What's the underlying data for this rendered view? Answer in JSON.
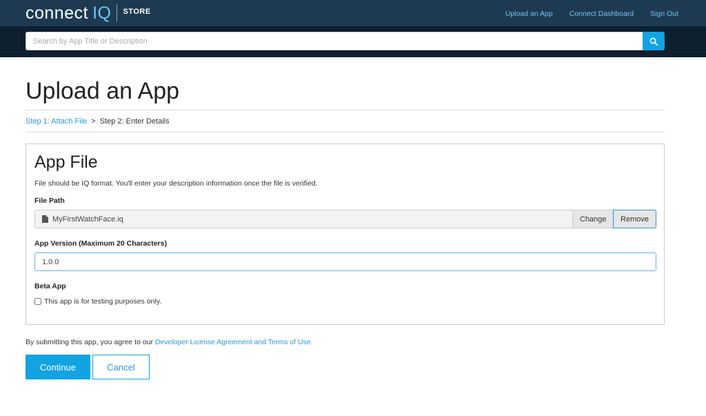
{
  "header": {
    "logo_connect": "connect",
    "logo_iq": "IQ",
    "logo_store": "STORE",
    "nav": [
      "Upload an App",
      "Connect Dashboard",
      "Sign Out"
    ]
  },
  "search": {
    "placeholder": "Search by App Title or Description",
    "value": "",
    "icon": "search-icon"
  },
  "page": {
    "title": "Upload an App",
    "breadcrumb": {
      "step1": "Step 1: Attach File",
      "separator": ">",
      "step2": "Step 2: Enter Details"
    }
  },
  "panel": {
    "title": "App File",
    "description": "File should be IQ format. You'll enter your description information once the file is verified.",
    "file_path_label": "File Path",
    "file_name": "MyFirstWatchFace.iq",
    "file_icon": "file-icon",
    "change_label": "Change",
    "remove_label": "Remove",
    "version_label": "App Version (Maximum 20 Characters)",
    "version_value": "1.0.0",
    "beta_label": "Beta App",
    "beta_checkbox_label": "This app is for testing purposes only.",
    "beta_checked": false
  },
  "footer": {
    "agree_text": "By submitting this app, you agree to our ",
    "agree_link": "Developer License Agreement and Terms of Use.",
    "continue_label": "Continue",
    "cancel_label": "Cancel"
  },
  "colors": {
    "topbar": "#1d3a52",
    "searchband": "#0e1f30",
    "accent": "#12a3e2",
    "link": "#2a96d9"
  }
}
